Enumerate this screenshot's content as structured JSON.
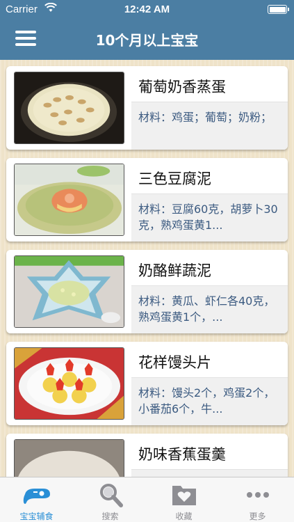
{
  "status_bar": {
    "carrier": "Carrier",
    "time": "12:42 AM"
  },
  "nav": {
    "title": "10个月以上宝宝"
  },
  "recipes": [
    {
      "name": "葡萄奶香蒸蛋",
      "desc": "材料：鸡蛋；葡萄；奶粉；"
    },
    {
      "name": "三色豆腐泥",
      "desc": "材料：豆腐60克，胡萝卜30克，熟鸡蛋黄1..."
    },
    {
      "name": "奶酪鲜蔬泥",
      "desc": "材料：黄瓜、虾仁各40克，熟鸡蛋黄1个，..."
    },
    {
      "name": "花样馒头片",
      "desc": "材料：馒头2个，鸡蛋2个，小番茄6个，牛..."
    },
    {
      "name": "奶味香蕉蛋羹",
      "desc": ""
    }
  ],
  "tabs": [
    {
      "label": "宝宝辅食",
      "icon": "baby-food-icon",
      "active": true
    },
    {
      "label": "搜索",
      "icon": "search-icon",
      "active": false
    },
    {
      "label": "收藏",
      "icon": "favorites-folder-icon",
      "active": false
    },
    {
      "label": "更多",
      "icon": "more-icon",
      "active": false
    }
  ],
  "colors": {
    "nav": "#4b7ea3",
    "accent": "#2a8fd6",
    "desc_text": "#3b5a80",
    "background": "#efe3c9"
  }
}
